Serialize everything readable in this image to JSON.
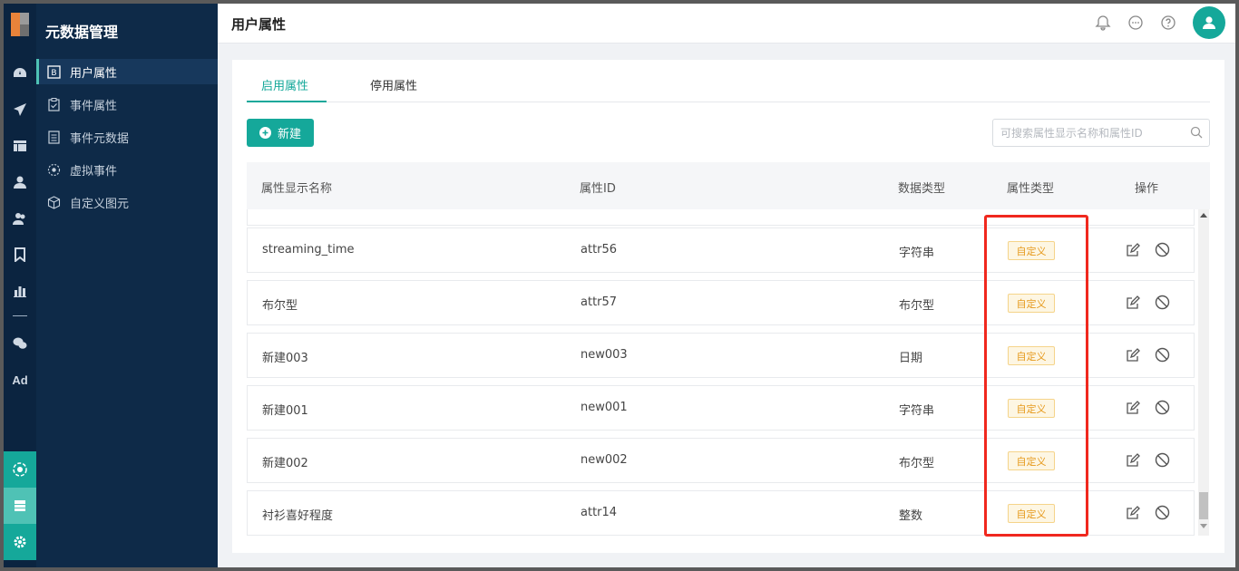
{
  "sidebar": {
    "title": "元数据管理",
    "items": [
      {
        "label": "用户属性",
        "icon": "bracket-b-icon"
      },
      {
        "label": "事件属性",
        "icon": "clipboard-check-icon"
      },
      {
        "label": "事件元数据",
        "icon": "list-doc-icon"
      },
      {
        "label": "虚拟事件",
        "icon": "dashed-circle-icon"
      },
      {
        "label": "自定义图元",
        "icon": "cube-icon"
      }
    ]
  },
  "rail": {
    "ad_label": "Ad",
    "icons": [
      "dashboard-icon",
      "send-icon",
      "layout-icon",
      "user-icon",
      "users-icon",
      "bookmark-icon",
      "bar-chart-icon",
      "wechat-icon",
      "ad-icon",
      "hub-icon",
      "server-icon",
      "gear-icon"
    ]
  },
  "header": {
    "title": "用户属性",
    "icons": [
      "bell-icon",
      "chat-icon",
      "help-icon",
      "avatar"
    ]
  },
  "tabs": [
    {
      "label": "启用属性",
      "active": true
    },
    {
      "label": "停用属性",
      "active": false
    }
  ],
  "toolbar": {
    "new_label": "新建",
    "search_placeholder": "可搜索属性显示名称和属性ID"
  },
  "table": {
    "headers": [
      "属性显示名称",
      "属性ID",
      "数据类型",
      "属性类型",
      "操作"
    ],
    "rows": [
      {
        "name": "streaming_time",
        "id": "attr56",
        "data_type": "字符串",
        "attr_type": "自定义"
      },
      {
        "name": "布尔型",
        "id": "attr57",
        "data_type": "布尔型",
        "attr_type": "自定义"
      },
      {
        "name": "新建003",
        "id": "new003",
        "data_type": "日期",
        "attr_type": "自定义"
      },
      {
        "name": "新建001",
        "id": "new001",
        "data_type": "字符串",
        "attr_type": "自定义"
      },
      {
        "name": "新建002",
        "id": "new002",
        "data_type": "布尔型",
        "attr_type": "自定义"
      },
      {
        "name": "衬衫喜好程度",
        "id": "attr14",
        "data_type": "整数",
        "attr_type": "自定义"
      }
    ]
  },
  "colors": {
    "accent": "#15a89a",
    "sidebar_bg": "#0e2a48",
    "rail_bg": "#0b2440",
    "tag_text": "#e69a1d",
    "highlight": "#f0281e"
  }
}
